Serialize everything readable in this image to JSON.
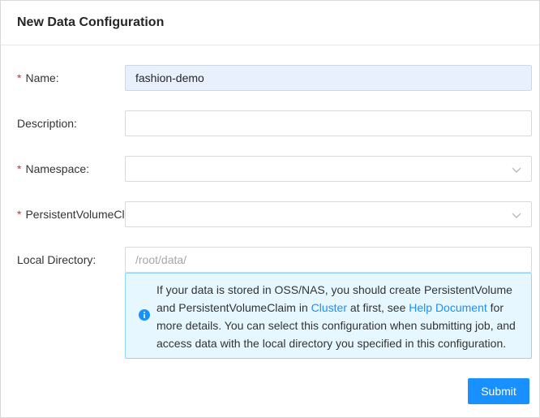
{
  "header": {
    "title": "New Data Configuration"
  },
  "form": {
    "name": {
      "required_mark": "*",
      "label": "Name:",
      "value": "fashion-demo"
    },
    "description": {
      "label": "Description:",
      "value": ""
    },
    "namespace": {
      "required_mark": "*",
      "label": "Namespace:",
      "value": ""
    },
    "pvc": {
      "required_mark": "*",
      "label": "PersistentVolumeClaim:",
      "value": ""
    },
    "local_directory": {
      "label": "Local Directory:",
      "placeholder": "/root/data/"
    }
  },
  "alert": {
    "text_1": "If your data is stored in OSS/NAS, you should create PersistentVolume and PersistentVolumeClaim in ",
    "link_cluster": "Cluster",
    "text_2": " at first, see ",
    "link_help": "Help Document",
    "text_3": " for more details. You can select this configuration when submitting job, and access data with the local directory you specified in this configuration."
  },
  "actions": {
    "submit_label": "Submit"
  },
  "icons": {
    "select_arrow": "chevron-down-icon",
    "alert_icon": "info-icon"
  },
  "colors": {
    "primary": "#1890ff",
    "required": "#f5222d",
    "alert_bg": "#e6f7ff",
    "autofill_bg": "#e8f0fe"
  }
}
